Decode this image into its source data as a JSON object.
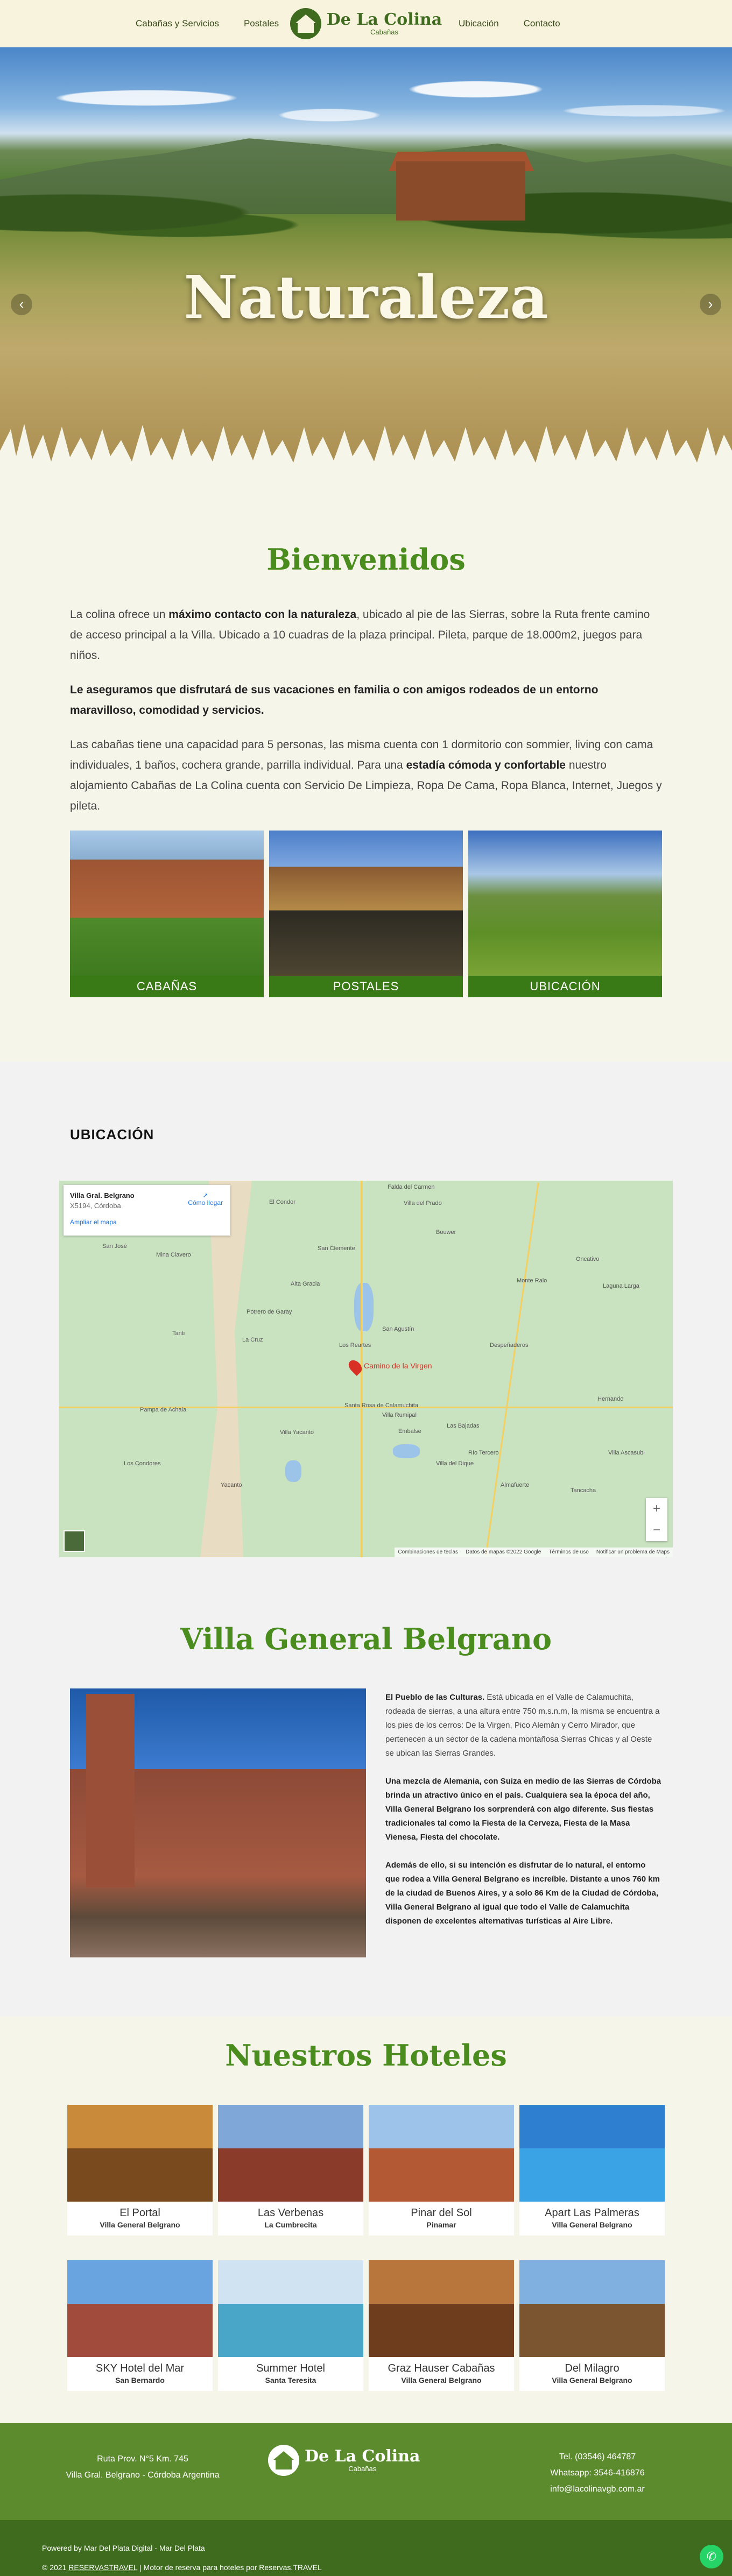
{
  "header": {
    "nav_left": [
      "Cabañas y Servicios",
      "Postales"
    ],
    "logo_title": "De La Colina",
    "logo_sub": "Cabañas",
    "nav_right": [
      "Ubicación",
      "Contacto"
    ]
  },
  "hero": {
    "title": "Naturaleza",
    "prev_icon": "chevron-left-icon",
    "next_icon": "chevron-right-icon"
  },
  "welcome": {
    "title": "Bienvenidos",
    "p1_a": "La colina ofrece un ",
    "p1_b": "máximo contacto con la naturaleza",
    "p1_c": ", ubicado al pie de las Sierras, sobre la Ruta frente camino de acceso principal a la Villa. Ubicado a 10 cuadras de la plaza principal. Pileta, parque de 18.000m2, juegos para niños.",
    "p2": "Le aseguramos que disfrutará de sus vacaciones en familia o con amigos rodeados de un entorno maravilloso, comodidad y servicios.",
    "p3_a": "Las cabañas tiene una capacidad para 5 personas, las misma cuenta con 1 dormitorio con sommier, living con cama individuales, 1 baños, cochera grande, parrilla individual. Para una ",
    "p3_b": "estadía cómoda y confortable",
    "p3_c": " nuestro alojamiento Cabañas de La Colina cuenta con Servicio De Limpieza, Ropa De Cama, Ropa Blanca, Internet, Juegos y pileta.",
    "cards": [
      "CABAÑAS",
      "POSTALES",
      "UBICACIÓN"
    ]
  },
  "ubicacion": {
    "title": "UBICACIÓN",
    "map_place": "Villa Gral. Belgrano",
    "map_region": "X5194, Córdoba",
    "map_directions": "Cómo llegar",
    "map_expand": "Ampliar el mapa",
    "pin_label": "Camino de la Virgen",
    "zoom_in": "+",
    "zoom_out": "−",
    "map_footer": [
      "Combinaciones de teclas",
      "Datos de mapas ©2022 Google",
      "Términos de uso",
      "Notificar un problema de Maps"
    ],
    "places": [
      "El Condor",
      "Falda del Carmen",
      "Villa del Prado",
      "San José",
      "Mina Clavero",
      "San Clemente",
      "Bouwer",
      "Alta Gracia",
      "Potrero de Garay",
      "San Agustín",
      "Villa Rumipal",
      "Embalse",
      "La Cruz",
      "Tanti",
      "Los Reartes",
      "Santa Rosa de Calamuchita",
      "Villa Yacanto",
      "Río Tercero",
      "Yacanto",
      "Pampa de Achala",
      "Los Condores",
      "Despeñaderos",
      "Monte Ralo",
      "Oncativo",
      "Laguna Larga",
      "Villa del Dique",
      "Las Bajadas",
      "Almafuerte",
      "Tancacha",
      "Villa Ascasubi",
      "Hernando"
    ]
  },
  "villa": {
    "title": "Villa General Belgrano",
    "p1_b": "El Pueblo de las Culturas.",
    "p1": " Está ubicada en el Valle de Calamuchita, rodeada de sierras, a una altura entre 750 m.s.n.m, la misma se encuentra a los pies de los cerros: De la Virgen, Pico Alemán y Cerro Mirador, que pertenecen a un sector de la cadena montañosa Sierras Chicas y al Oeste se ubican las Sierras Grandes.",
    "p2": "Una mezcla de Alemania, con Suiza en medio de las Sierras de Córdoba brinda un atractivo único en el país. Cualquiera sea la época del año, Villa General Belgrano los sorprenderá con algo diferente. Sus fiestas tradicionales tal como la Fiesta de la Cerveza, Fiesta de la Masa Vienesa, Fiesta del chocolate.",
    "p3": "Además de ello, si su intención es disfrutar de lo natural, el entorno que rodea a Villa General Belgrano es increíble. Distante a unos 760 km de la ciudad de Buenos Aires, y a solo 86 Km de la Ciudad de Córdoba, Villa General Belgrano al igual que todo el Valle de Calamuchita disponen de excelentes alternativas turísticas al Aire Libre."
  },
  "hotels": {
    "title": "Nuestros Hoteles",
    "items": [
      {
        "name": "El Portal",
        "loc": "Villa General Belgrano",
        "c1": "#c98a3a",
        "c2": "#7a4a1f"
      },
      {
        "name": "Las Verbenas",
        "loc": "La Cumbrecita",
        "c1": "#7fa7d8",
        "c2": "#8a3b2a"
      },
      {
        "name": "Pinar del Sol",
        "loc": "Pinamar",
        "c1": "#9ec3ea",
        "c2": "#b35a34"
      },
      {
        "name": "Apart Las Palmeras",
        "loc": "Villa General Belgrano",
        "c1": "#2e7fd0",
        "c2": "#3aa3e6"
      },
      {
        "name": "SKY Hotel del Mar",
        "loc": "San Bernardo",
        "c1": "#6aa4e0",
        "c2": "#a04b3c"
      },
      {
        "name": "Summer Hotel",
        "loc": "Santa Teresita",
        "c1": "#cfe3f3",
        "c2": "#4aa6c9"
      },
      {
        "name": "Graz Hauser Cabañas",
        "loc": "Villa General Belgrano",
        "c1": "#b9763c",
        "c2": "#6e3d1e"
      },
      {
        "name": "Del Milagro",
        "loc": "Villa General Belgrano",
        "c1": "#7fb0e0",
        "c2": "#7a5530"
      }
    ]
  },
  "footer": {
    "address1": "Ruta Prov. N°5 Km. 745",
    "address2": "Villa Gral. Belgrano - Córdoba Argentina",
    "phone": "Tel. (03546) 464787",
    "whatsapp": "Whatsapp: 3546-416876",
    "email": "info@lacolinavgb.com.ar",
    "powered_a": "Powered by Mar Del Plata Digital - Mar Del Plata",
    "copyright": "© 2021",
    "reservas_link": "RESERVASTRAVEL",
    "motor": "|  Motor de reserva para hoteles por Reservas.TRAVEL",
    "wa_icon": "whatsapp-icon"
  }
}
